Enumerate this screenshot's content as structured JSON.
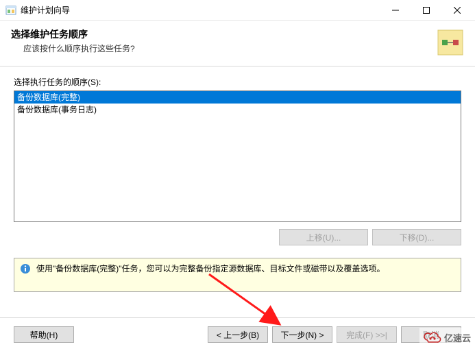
{
  "window": {
    "title": "维护计划向导"
  },
  "header": {
    "heading": "选择维护任务顺序",
    "subheading": "应该按什么顺序执行这些任务?"
  },
  "list": {
    "label": "选择执行任务的顺序(S):",
    "items": [
      {
        "text": "备份数据库(完整)",
        "selected": true
      },
      {
        "text": "备份数据库(事务日志)",
        "selected": false
      }
    ]
  },
  "buttons": {
    "move_up": "上移(U)...",
    "move_down": "下移(D)...",
    "help": "帮助(H)",
    "back": "< 上一步(B)",
    "next": "下一步(N) >",
    "finish": "完成(F) >>|",
    "cancel": "取消"
  },
  "hint": {
    "text": "使用\"备份数据库(完整)\"任务，您可以为完整备份指定源数据库、目标文件或磁带以及覆盖选项。"
  },
  "watermark": {
    "text": "亿速云"
  },
  "colors": {
    "selection": "#0078d7",
    "hint_bg": "#ffffe1"
  }
}
